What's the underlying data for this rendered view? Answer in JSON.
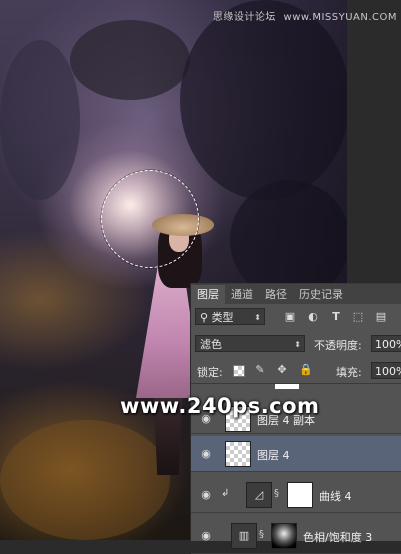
{
  "watermark": {
    "left": "思缘设计论坛",
    "right": "www.MISSYUAN.COM"
  },
  "site_mark": "www.240ps.com",
  "layers_panel": {
    "tabs": [
      "图层",
      "通道",
      "路径",
      "历史记录"
    ],
    "active_tab": "图层",
    "filter": {
      "label": "类型",
      "icons": [
        "image-filter-icon",
        "adjustment-filter-icon",
        "type-filter-icon",
        "shape-filter-icon",
        "smart-object-filter-icon"
      ]
    },
    "blend_mode": "滤色",
    "opacity_label": "不透明度:",
    "opacity_value": "100%",
    "lock_label": "锁定:",
    "fill_label": "填充:",
    "fill_value": "100%",
    "layers": [
      {
        "name": "图层 4 副本",
        "selected": false
      },
      {
        "name": "图层 4",
        "selected": true
      },
      {
        "name": "曲线 4",
        "selected": false
      },
      {
        "name": "色相/饱和度 3",
        "selected": false
      }
    ]
  },
  "colors": {
    "panel_bg": "#535353",
    "selected_layer": "#5a6478"
  }
}
